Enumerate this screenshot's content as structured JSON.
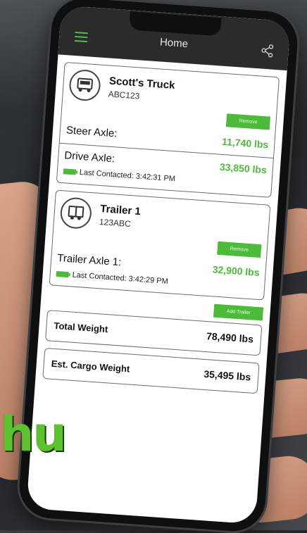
{
  "app": {
    "title": "Home"
  },
  "icons": {
    "menu": "hamburger-icon",
    "share": "share-icon",
    "truck": "truck-icon",
    "trailer": "trailer-icon",
    "battery": "battery-icon"
  },
  "colors": {
    "accent": "#4cbb3a",
    "appbar": "#2b2b2b"
  },
  "truck": {
    "name": "Scott's Truck",
    "id": "ABC123",
    "remove_label": "Remove",
    "axles": [
      {
        "label": "Steer Axle:",
        "weight": "11,740 lbs",
        "last_contacted": ""
      },
      {
        "label": "Drive Axle:",
        "weight": "33,850 lbs",
        "last_contacted": "Last Contacted: 3:42:31 PM"
      }
    ]
  },
  "trailer": {
    "name": "Trailer 1",
    "id": "123ABC",
    "remove_label": "Remove",
    "axles": [
      {
        "label": "Trailer Axle 1:",
        "weight": "32,900 lbs",
        "last_contacted": "Last Contacted: 3:42:29 PM"
      }
    ]
  },
  "add_trailer_label": "Add Trailer",
  "totals": {
    "total_weight_label": "Total Weight",
    "total_weight_value": "78,490 lbs",
    "cargo_label": "Est. Cargo Weight",
    "cargo_value": "35,495 lbs"
  },
  "logo_text": "hu"
}
